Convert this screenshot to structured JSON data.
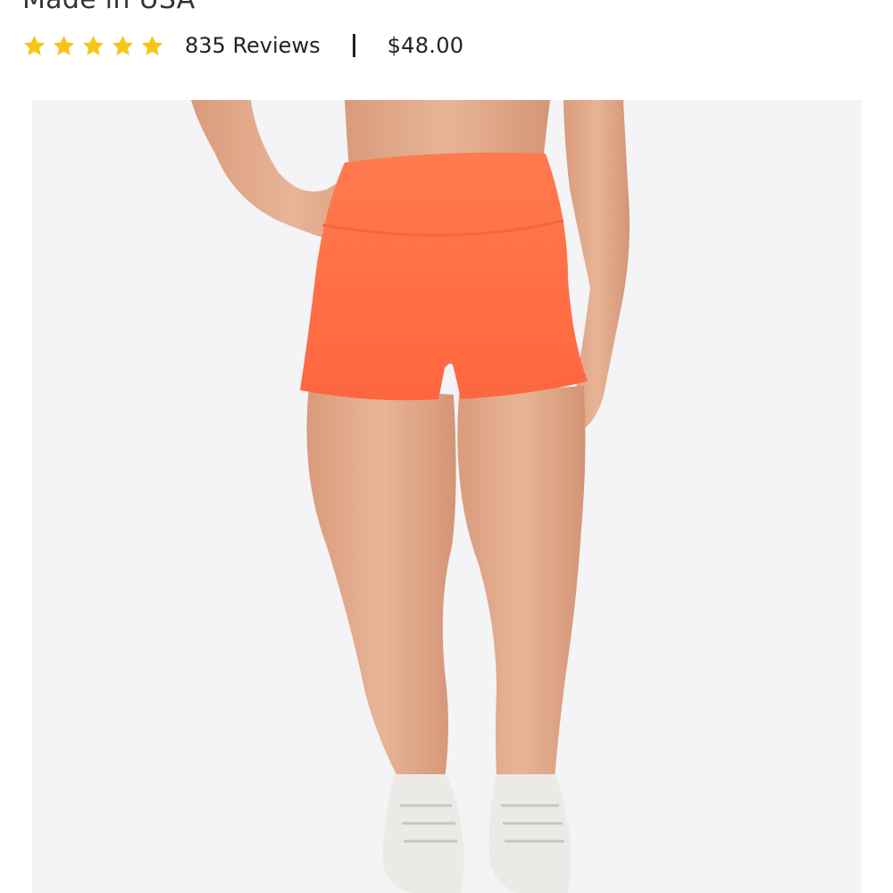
{
  "product": {
    "subtitle": "Made in USA",
    "rating": {
      "stars": 5,
      "max_stars": 5,
      "star_color": "#f5c518",
      "reviews_label": "835 Reviews"
    },
    "price": "$48.00",
    "image": {
      "description_icon": "product-photo",
      "shorts_color": "#ff6b45",
      "background_color": "#f4f3f6"
    }
  }
}
